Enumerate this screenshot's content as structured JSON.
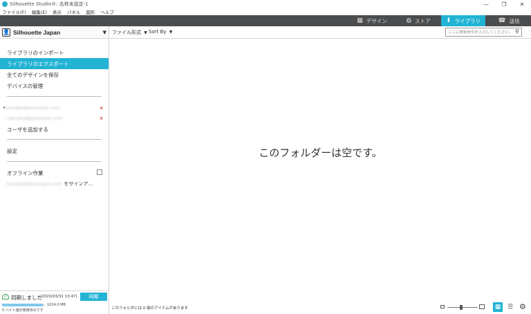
{
  "window": {
    "title": "Silhouette Studio®: 名称未設定-1",
    "controls": [
      "—",
      "❐",
      "✕"
    ]
  },
  "menu": [
    "ファイル(F)",
    "編集(E)",
    "表示",
    "パネル",
    "図形",
    "ヘルプ"
  ],
  "nav_tabs": [
    {
      "label": "デザイン",
      "icon": "grid-icon",
      "glyph": "▦"
    },
    {
      "label": "ストア",
      "icon": "globe-icon",
      "glyph": "◍"
    },
    {
      "label": "ライブラリ",
      "icon": "download-icon",
      "glyph": "⬇"
    },
    {
      "label": "送信",
      "icon": "cutter-icon",
      "glyph": "☎"
    }
  ],
  "colors": {
    "accent": "#22b3d4",
    "nav_bg": "#4a4c4e",
    "remove": "#d64545",
    "sync_ok": "#2d9f4c"
  },
  "account": {
    "name": "Silhouette Japan",
    "arrow": "▼"
  },
  "sidebar_menu": [
    {
      "label": "ライブラリのインポート",
      "selected": false
    },
    {
      "label": "ライブラリのエクスポート",
      "selected": true
    },
    {
      "label": "全てのデザインを保存",
      "selected": false
    },
    {
      "label": "デバイスの管理",
      "selected": false
    }
  ],
  "users": [
    {
      "email": "hanako@example.com",
      "active": true,
      "remove": "✕"
    },
    {
      "email": "r.tanaka@example.com",
      "active": false,
      "remove": "✕"
    }
  ],
  "add_user": "ユーザを追加する",
  "settings": "設定",
  "offline": {
    "label": "オフライン作業",
    "checked": false
  },
  "signin": {
    "email": "hanako@example.com",
    "suffix": "をサインア..."
  },
  "sync": {
    "status": "同期しました",
    "time": "(2020/03/31 13:47)",
    "button": "同期",
    "storage_size": "1024.0 MB",
    "storage_used_fraction": 0.95,
    "storage_text": "0 バイト値が使用済みです"
  },
  "toolbar": {
    "file_format": "ファイル形式",
    "sort_by": "Sort By",
    "arrow": "▼",
    "search_placeholder": "ここに検索条件を入力してください。"
  },
  "main": {
    "empty_message": "このフォルダーは空です。"
  },
  "statusbar": {
    "text": "このフォルダには 0 個のアイテムがあります"
  }
}
